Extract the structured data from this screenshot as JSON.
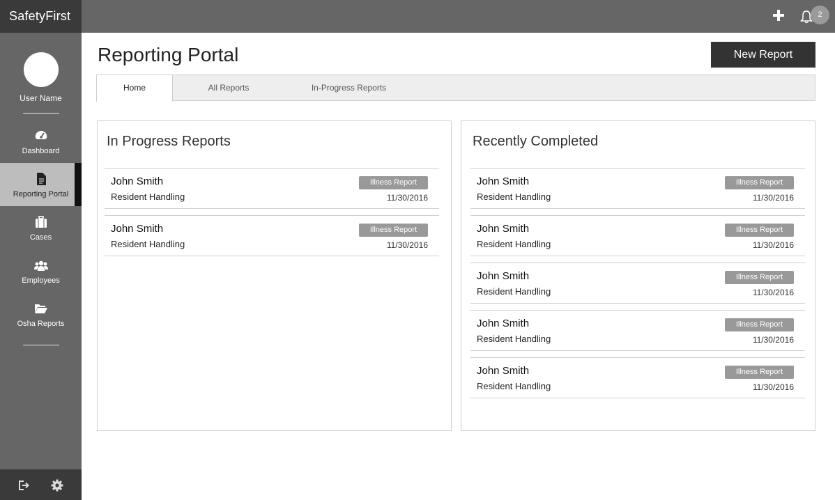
{
  "brand": {
    "name": "SafetyFirst"
  },
  "user": {
    "name": "User Name"
  },
  "sidebar": {
    "items": [
      {
        "label": "Dashboard",
        "icon": "gauge-icon"
      },
      {
        "label": "Reporting Portal",
        "icon": "document-icon",
        "active": true
      },
      {
        "label": "Cases",
        "icon": "briefcase-icon"
      },
      {
        "label": "Employees",
        "icon": "users-icon"
      },
      {
        "label": "Osha Reports",
        "icon": "folder-open-icon"
      }
    ],
    "bottom": [
      {
        "icon": "logout-icon"
      },
      {
        "icon": "gear-icon"
      }
    ]
  },
  "topbar": {
    "add_icon": "plus-icon",
    "notification_icon": "bell-icon",
    "notification_count": "2"
  },
  "main": {
    "title": "Reporting Portal",
    "new_report_label": "New Report",
    "tabs": [
      {
        "label": "Home",
        "active": true
      },
      {
        "label": "All Reports"
      },
      {
        "label": "In-Progress Reports"
      }
    ]
  },
  "in_progress": {
    "title": "In Progress Reports",
    "rows": [
      {
        "name": "John Smith",
        "category": "Resident Handling",
        "tag": "Illness Report",
        "date": "11/30/2016"
      },
      {
        "name": "John Smith",
        "category": "Resident Handling",
        "tag": "Illness Report",
        "date": "11/30/2016"
      }
    ]
  },
  "completed": {
    "title": "Recently Completed",
    "rows": [
      {
        "name": "John Smith",
        "category": "Resident Handling",
        "tag": "Illness Report",
        "date": "11/30/2016"
      },
      {
        "name": "John Smith",
        "category": "Resident Handling",
        "tag": "Illness Report",
        "date": "11/30/2016"
      },
      {
        "name": "John Smith",
        "category": "Resident Handling",
        "tag": "Illness Report",
        "date": "11/30/2016"
      },
      {
        "name": "John Smith",
        "category": "Resident Handling",
        "tag": "Illness Report",
        "date": "11/30/2016"
      },
      {
        "name": "John Smith",
        "category": "Resident Handling",
        "tag": "Illness Report",
        "date": "11/30/2016"
      }
    ]
  },
  "colors": {
    "sidebar_bg": "#666666",
    "brand_bg": "#3a3a3a",
    "active_nav_bg": "#bdbdbd",
    "button_bg": "#333333",
    "tag_bg": "#999999"
  }
}
